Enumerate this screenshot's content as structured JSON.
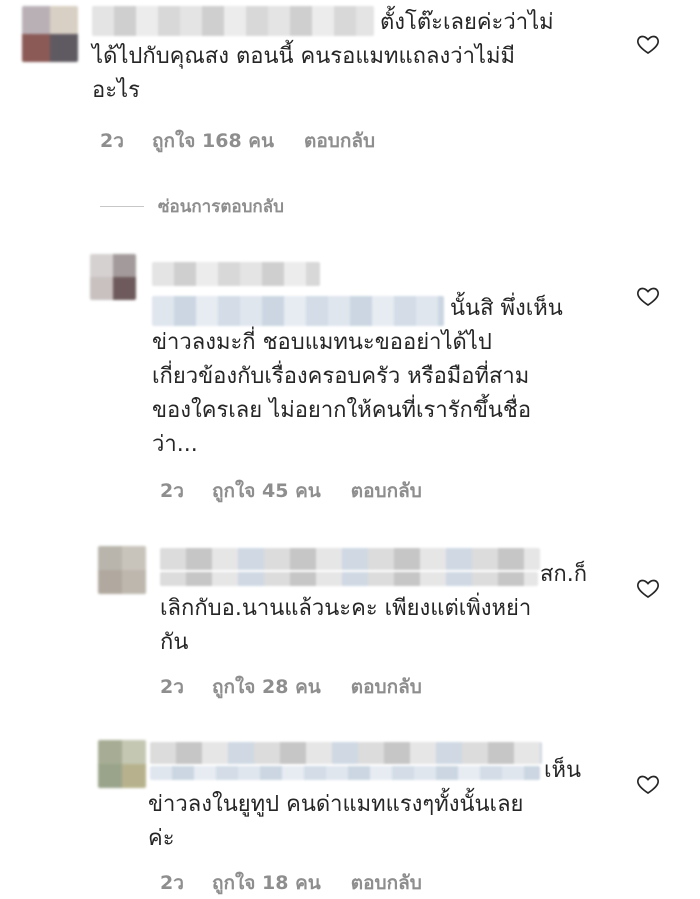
{
  "comments": [
    {
      "text": "ตั้งโต๊ะเลยค่ะว่าไม่\nได้ไปกับคุณสง ตอนนี้ คนรอแมทแถลงว่าไม่มี\nอะไร",
      "time": "2ว",
      "likes": "ถูกใจ 168 คน",
      "reply": "ตอบกลับ",
      "heart_icon": "heart-outline-icon"
    },
    {
      "text": "นั้นสิ พึ่งเห็น\nข่าวลงมะกี่ ชอบแมทนะขออย่าได้ไป\nเกี่ยวข้องกับเรื่องครอบครัว หรือมือที่สาม\nของใครเลย ไม่อยากให้คนที่เรารักขึ้นชื่อ\nว่า...",
      "time": "2ว",
      "likes": "ถูกใจ 45 คน",
      "reply": "ตอบกลับ",
      "heart_icon": "heart-outline-icon"
    },
    {
      "text": "สก.ก็\nเลิกกับอ.นานแล้วนะคะ เพียงแต่เพิ่งหย่า\nกัน",
      "time": "2ว",
      "likes": "ถูกใจ 28 คน",
      "reply": "ตอบกลับ",
      "heart_icon": "heart-outline-icon"
    },
    {
      "text": "เห็น\nข่าวลงในยูทูป คนด่าแมทแรงๆทั้งนั้นเลย\nค่ะ",
      "time": "2ว",
      "likes": "ถูกใจ 18 คน",
      "reply": "ตอบกลับ",
      "heart_icon": "heart-outline-icon"
    }
  ],
  "hide_replies": "ซ่อนการตอบกลับ"
}
